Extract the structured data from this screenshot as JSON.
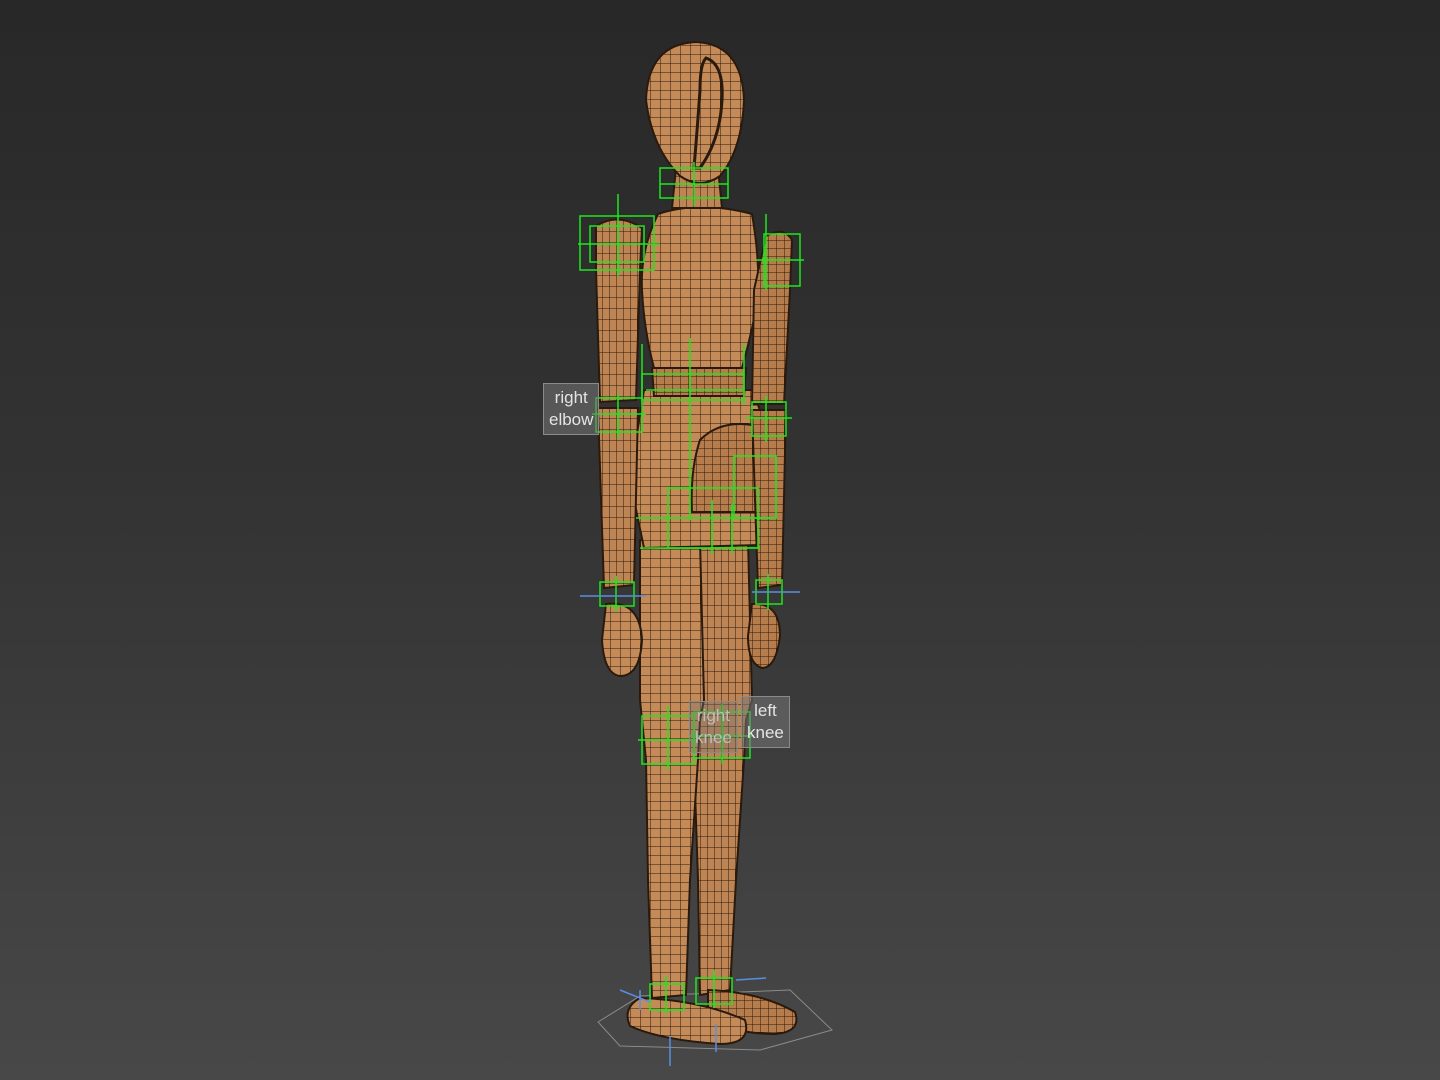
{
  "scene": {
    "model": "wooden-artist-mannequin",
    "view": "perspective",
    "shading": "smooth-with-edged-faces",
    "background_top": "#282828",
    "background_bottom": "#484848",
    "skin_color": "#C48A58",
    "wire_color": "#2A1A0D",
    "control_color": "#1EE61E",
    "axis_color": "#5A8FE0"
  },
  "labels": {
    "right_elbow": {
      "line1": "right",
      "line2": "elbow"
    },
    "right_knee": {
      "line1": "right",
      "line2": "knee"
    },
    "left_knee": {
      "line1": "left",
      "line2": "knee"
    }
  }
}
